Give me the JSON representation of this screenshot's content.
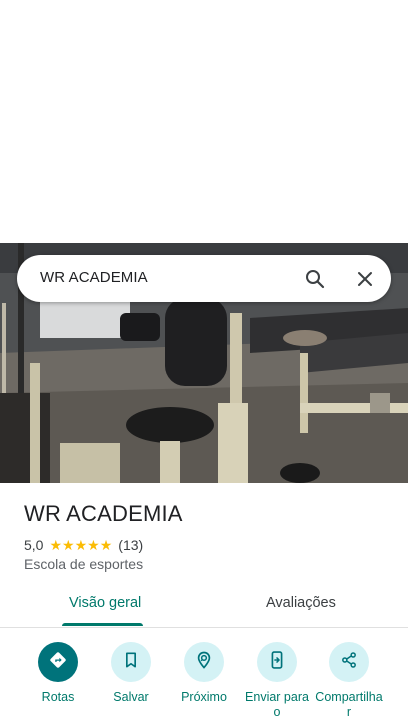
{
  "search": {
    "query": "WR ACADEMIA"
  },
  "place": {
    "name": "WR ACADEMIA",
    "rating": "5,0",
    "stars": 5,
    "review_count": "(13)",
    "category": "Escola de esportes"
  },
  "tabs": [
    {
      "label": "Visão geral",
      "selected": true
    },
    {
      "label": "Avaliações",
      "selected": false
    }
  ],
  "actions": [
    {
      "label": "Rotas",
      "icon": "directions-icon"
    },
    {
      "label": "Salvar",
      "icon": "bookmark-icon"
    },
    {
      "label": "Próximo",
      "icon": "nearby-icon"
    },
    {
      "label": "Enviar para o",
      "icon": "send-to-phone-icon"
    },
    {
      "label": "Compartilhar",
      "icon": "share-icon"
    }
  ],
  "colors": {
    "accent": "#00796b",
    "action_bg": "#d4f2f5",
    "primary_action": "#00737b",
    "star": "#fbbc04"
  }
}
